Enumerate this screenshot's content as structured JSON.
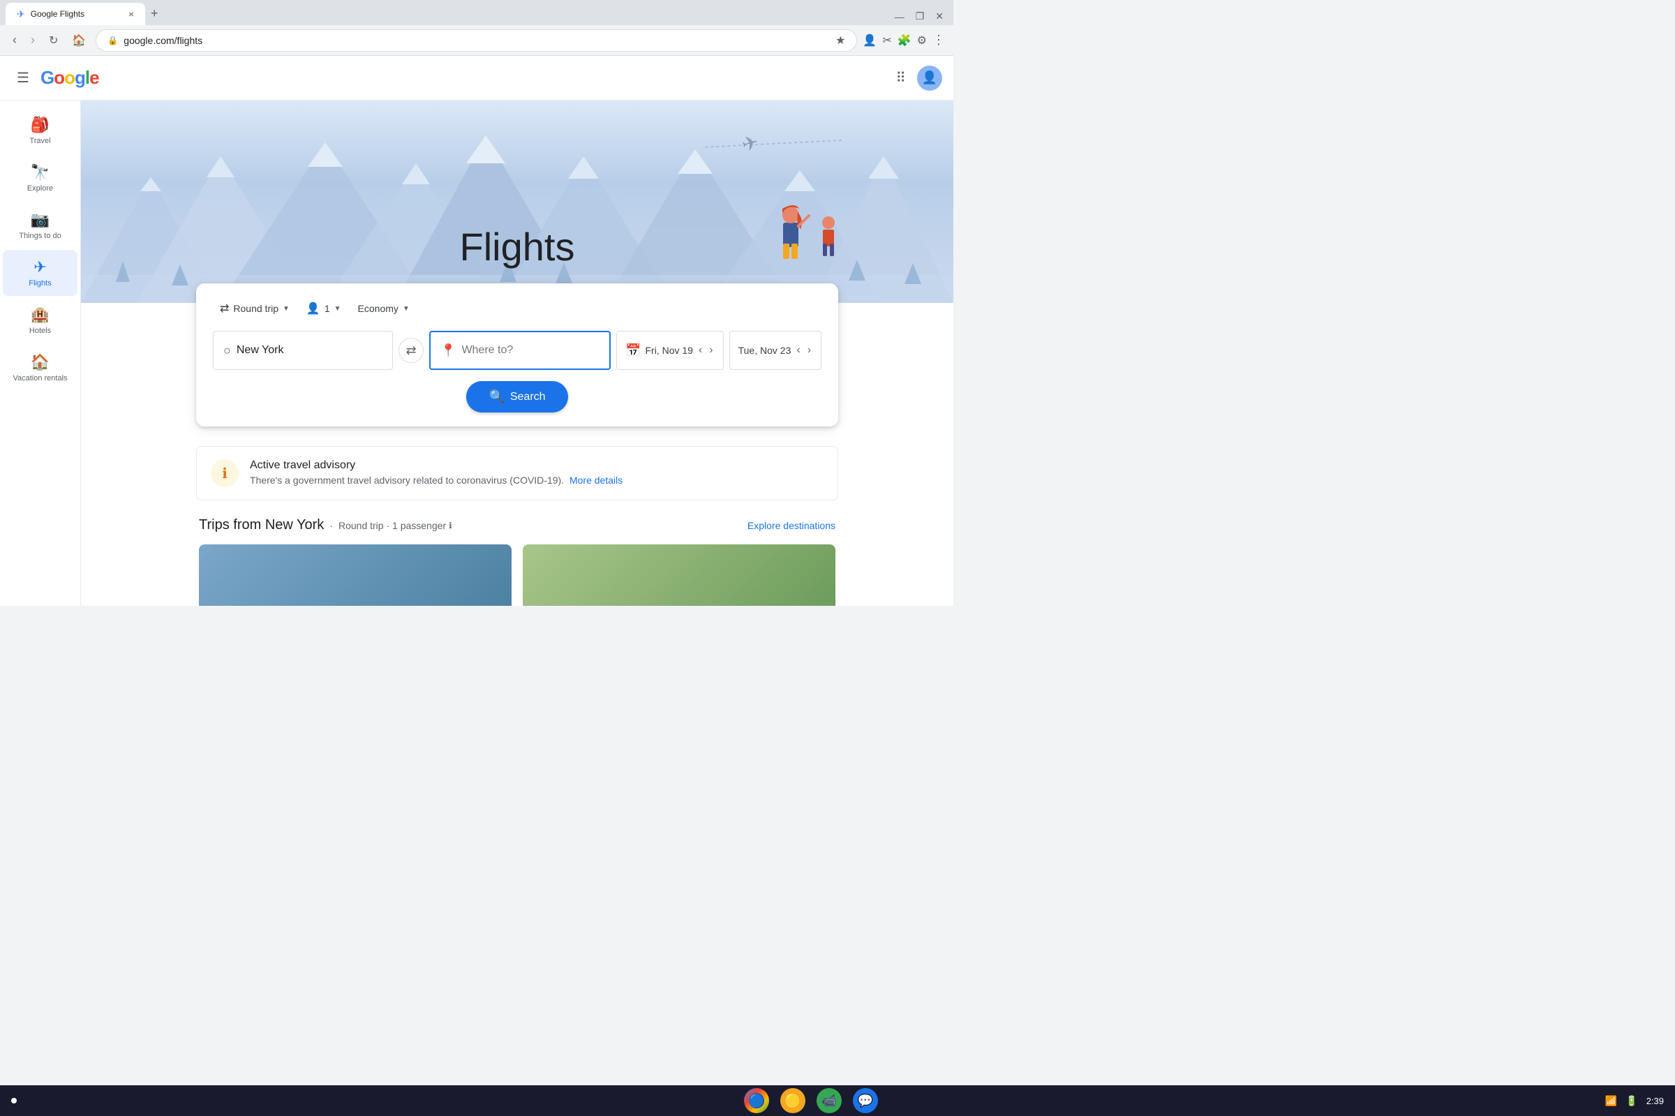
{
  "browser": {
    "tab_title": "Google Flights",
    "tab_favicon": "✈",
    "url": "google.com/flights",
    "new_tab_label": "+",
    "close_tab": "×",
    "minimize": "—",
    "maximize": "❐",
    "close_win": "✕"
  },
  "header": {
    "google_logo": "Google",
    "hamburger_icon": "☰",
    "grid_icon": "⋮⋮⋮",
    "apps_label": "Google apps"
  },
  "sidebar": {
    "items": [
      {
        "id": "travel",
        "label": "Travel",
        "icon": "🎒"
      },
      {
        "id": "explore",
        "label": "Explore",
        "icon": "🔍"
      },
      {
        "id": "things-to-do",
        "label": "Things to do",
        "icon": "📷"
      },
      {
        "id": "flights",
        "label": "Flights",
        "icon": "✈",
        "active": true
      },
      {
        "id": "hotels",
        "label": "Hotels",
        "icon": "🏨"
      },
      {
        "id": "vacation-rentals",
        "label": "Vacation rentals",
        "icon": "🏠"
      }
    ]
  },
  "hero": {
    "title": "Flights"
  },
  "search_form": {
    "trip_type": "Round trip",
    "passengers": "1",
    "cabin_class": "Economy",
    "from_value": "New York",
    "to_placeholder": "Where to?",
    "departure_date": "Fri, Nov 19",
    "return_date": "Tue, Nov 23",
    "search_label": "Search",
    "swap_icon": "⇄",
    "calendar_icon": "📅",
    "location_icon": "📍",
    "circle_icon": "○"
  },
  "advisory": {
    "icon": "ℹ",
    "title": "Active travel advisory",
    "text": "There's a government travel advisory related to coronavirus (COVID-19).",
    "link_label": "More details"
  },
  "trips_section": {
    "title": "Trips from New York",
    "subtitle": "Round trip · 1 passenger",
    "info_icon": "ℹ",
    "explore_label": "Explore destinations"
  },
  "taskbar": {
    "dot_icon": "●",
    "time": "2:39",
    "chrome_icon": "🔵",
    "spotify_icon": "🟡",
    "meet_icon": "🟢",
    "chat_icon": "🟩",
    "wifi_icon": "WiFi",
    "battery_icon": "🔋"
  },
  "colors": {
    "accent_blue": "#1a73e8",
    "sidebar_active": "#1a73e8",
    "google_blue": "#4285f4",
    "google_red": "#ea4335",
    "google_yellow": "#fbbc05",
    "google_green": "#34a853"
  }
}
